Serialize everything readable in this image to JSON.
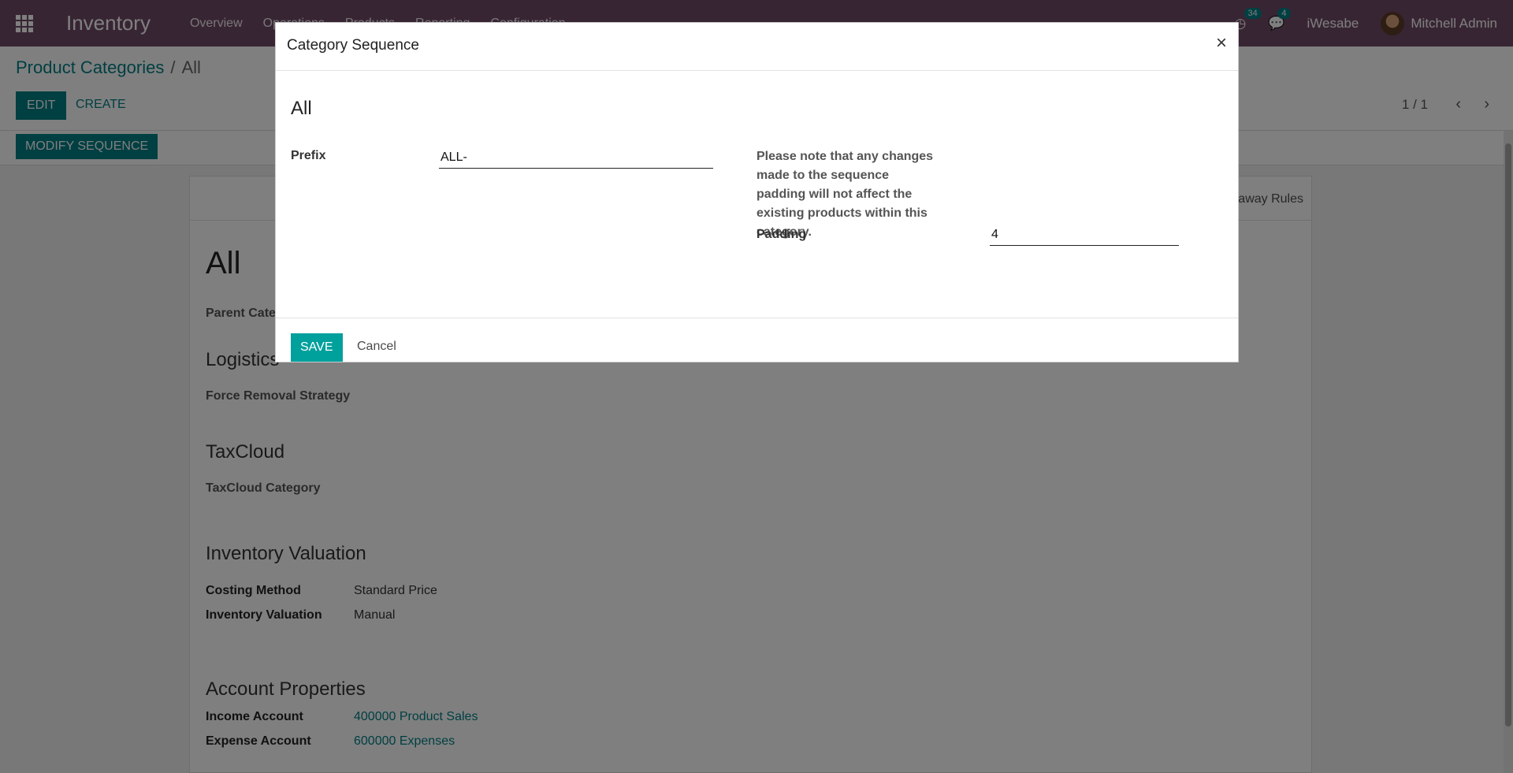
{
  "navbar": {
    "brand": "Inventory",
    "menu": [
      "Overview",
      "Operations",
      "Products",
      "Reporting",
      "Configuration"
    ],
    "activity_count": "34",
    "messages_count": "4",
    "company": "iWesabe",
    "user": "Mitchell Admin"
  },
  "control_panel": {
    "breadcrumb_parent": "Product Categories",
    "breadcrumb_sep": "/",
    "breadcrumb_current": "All",
    "edit_label": "EDIT",
    "create_label": "CREATE",
    "pager": "1 / 1",
    "modify_sequence_label": "MODIFY SEQUENCE"
  },
  "sheet": {
    "tab_putaway": "Putaway Rules",
    "title": "All",
    "parent_category_label": "Parent Category",
    "logistics_heading": "Logistics",
    "force_removal_label": "Force Removal Strategy",
    "taxcloud_heading": "TaxCloud",
    "taxcloud_category_label": "TaxCloud Category",
    "valuation_heading": "Inventory Valuation",
    "costing_method_label": "Costing Method",
    "costing_method_value": "Standard Price",
    "inventory_valuation_label": "Inventory Valuation",
    "inventory_valuation_value": "Manual",
    "account_heading": "Account Properties",
    "income_account_label": "Income Account",
    "income_account_value": "400000 Product Sales",
    "expense_account_label": "Expense Account",
    "expense_account_value": "600000 Expenses"
  },
  "modal": {
    "title": "Category Sequence",
    "close": "×",
    "record_name": "All",
    "prefix_label": "Prefix",
    "prefix_value": "ALL-",
    "note": "Please note that any changes made to the sequence padding will not affect the existing products within this category.",
    "padding_label": "Padding",
    "padding_value": "4",
    "save_label": "SAVE",
    "cancel_label": "Cancel"
  }
}
